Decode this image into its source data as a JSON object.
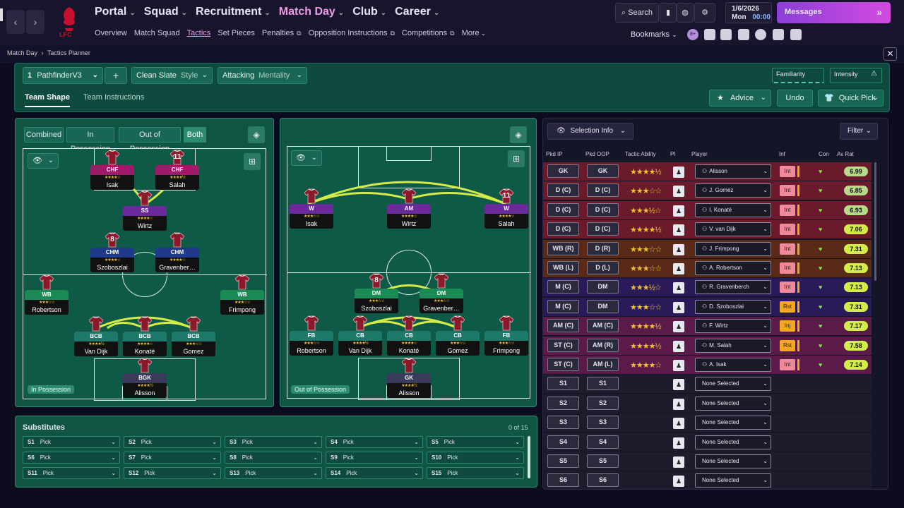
{
  "topbar": {
    "nav": [
      {
        "label": "Portal",
        "active": false
      },
      {
        "label": "Squad",
        "active": false
      },
      {
        "label": "Recruitment",
        "active": false
      },
      {
        "label": "Match Day",
        "active": true
      },
      {
        "label": "Club",
        "active": false
      },
      {
        "label": "Career",
        "active": false
      }
    ],
    "subnav": [
      "Overview",
      "Match Squad",
      "Tactics",
      "Set Pieces",
      "Penalties",
      "Opposition Instructions",
      "Competitions",
      "More"
    ],
    "subnav_active": "Tactics",
    "search_label": "Search",
    "date_line1": "1/6/2026",
    "date_day": "Mon",
    "date_time": "00:00",
    "messages_label": "Messages",
    "bookmarks_label": "Bookmarks",
    "badge": "8+",
    "crest_text": "LFC"
  },
  "breadcrumb": {
    "parent": "Match Day",
    "current": "Tactics Planner"
  },
  "tactic": {
    "number": "1",
    "name": "PathfinderV3",
    "add": "+",
    "style": "Clean Slate",
    "style_label": "Style",
    "mentality": "Attacking",
    "mentality_label": "Mentality",
    "familiarity": "Familiarity",
    "intensity": "Intensity"
  },
  "tabs": {
    "shape": "Team Shape",
    "instructions": "Team Instructions"
  },
  "actions": {
    "advice": "Advice",
    "undo": "Undo",
    "quick_pick": "Quick Pick"
  },
  "phase_buttons": [
    "Combined",
    "In Possession",
    "Out of Possession",
    "Both"
  ],
  "phase_active": "Both",
  "pitch_labels": {
    "in": "In Possession",
    "out": "Out of Possession"
  },
  "in_possession": [
    {
      "role": "CHF",
      "name": "Isak",
      "num": "",
      "rc": "r-pink",
      "stars": "★★★★☆"
    },
    {
      "role": "CHF",
      "name": "Salah",
      "num": "11",
      "rc": "r-pink",
      "stars": "★★★★½"
    },
    {
      "role": "SS",
      "name": "Wirtz",
      "num": "",
      "rc": "r-purple",
      "stars": "★★★★☆"
    },
    {
      "role": "CHM",
      "name": "Szoboszlai",
      "num": "8",
      "rc": "r-blue",
      "stars": "★★★★☆"
    },
    {
      "role": "CHM",
      "name": "Gravenber…",
      "num": "",
      "rc": "r-blue",
      "stars": "★★★★☆"
    },
    {
      "role": "WB",
      "name": "Robertson",
      "num": "",
      "rc": "r-green",
      "stars": "★★★☆☆"
    },
    {
      "role": "WB",
      "name": "Frimpong",
      "num": "",
      "rc": "r-green",
      "stars": "★★★☆☆"
    },
    {
      "role": "BCB",
      "name": "Van Dijk",
      "num": "",
      "rc": "r-teal",
      "stars": "★★★★½"
    },
    {
      "role": "BCB",
      "name": "Konaté",
      "num": "",
      "rc": "r-teal",
      "stars": "★★★★☆"
    },
    {
      "role": "BCB",
      "name": "Gomez",
      "num": "",
      "rc": "r-teal",
      "stars": "★★★☆☆"
    },
    {
      "role": "BGK",
      "name": "Alisson",
      "num": "",
      "rc": "r-gk",
      "stars": "★★★★½"
    }
  ],
  "out_possession": [
    {
      "role": "W",
      "name": "Isak",
      "num": "",
      "rc": "r-purple",
      "stars": "★★★☆☆"
    },
    {
      "role": "AM",
      "name": "Wirtz",
      "num": "",
      "rc": "r-purple",
      "stars": "★★★★☆"
    },
    {
      "role": "W",
      "name": "Salah",
      "num": "11",
      "rc": "r-purple",
      "stars": "★★★★☆"
    },
    {
      "role": "DM",
      "name": "Szoboszlai",
      "num": "8",
      "rc": "r-green",
      "stars": "★★★☆☆"
    },
    {
      "role": "DM",
      "name": "Gravenber…",
      "num": "",
      "rc": "r-green",
      "stars": "★★★☆☆"
    },
    {
      "role": "FB",
      "name": "Robertson",
      "num": "",
      "rc": "r-teal",
      "stars": "★★★☆☆"
    },
    {
      "role": "CB",
      "name": "Van Dijk",
      "num": "",
      "rc": "r-teal",
      "stars": "★★★★½"
    },
    {
      "role": "CB",
      "name": "Konaté",
      "num": "",
      "rc": "r-teal",
      "stars": "★★★★☆"
    },
    {
      "role": "CB",
      "name": "Gomez",
      "num": "",
      "rc": "r-teal",
      "stars": "★★★☆☆"
    },
    {
      "role": "FB",
      "name": "Frimpong",
      "num": "",
      "rc": "r-teal",
      "stars": "★★★☆☆"
    },
    {
      "role": "GK",
      "name": "Alisson",
      "num": "",
      "rc": "r-gk",
      "stars": "★★★★½"
    }
  ],
  "substitutes": {
    "title": "Substitutes",
    "count": "0 of 15",
    "slots": [
      "S1",
      "S2",
      "S3",
      "S4",
      "S5",
      "S6",
      "S7",
      "S8",
      "S9",
      "S10",
      "S11",
      "S12",
      "S13",
      "S14",
      "S15"
    ],
    "placeholder": "Pick"
  },
  "selection": {
    "title": "Selection Info",
    "filter": "Filter",
    "headers": [
      "Pkd IP",
      "Pkd OOP",
      "Tactic Ability",
      "PI",
      "Player",
      "Inf",
      "Con",
      "Av Rat"
    ],
    "rows": [
      {
        "ip": "GK",
        "oop": "GK",
        "stars": "★★★★½",
        "player": "Alisson",
        "inf": "Int",
        "rating": "6.99",
        "bg": "#6a1a2a",
        "rc": "#b8d98a"
      },
      {
        "ip": "D (C)",
        "oop": "D (C)",
        "stars": "★★★☆☆",
        "player": "J. Gomez",
        "inf": "Int",
        "rating": "6.85",
        "bg": "#6a1a2a",
        "rc": "#b8d98a"
      },
      {
        "ip": "D (C)",
        "oop": "D (C)",
        "stars": "★★★½☆",
        "player": "I. Konaté",
        "inf": "Int",
        "rating": "6.93",
        "bg": "#6a1a2a",
        "rc": "#b8d98a"
      },
      {
        "ip": "D (C)",
        "oop": "D (C)",
        "stars": "★★★★½",
        "player": "V. van Dijk",
        "inf": "Int",
        "rating": "7.06",
        "bg": "#6a1a2a",
        "rc": "#d4ec4a"
      },
      {
        "ip": "WB (R)",
        "oop": "D (R)",
        "stars": "★★★☆☆",
        "player": "J. Frimpong",
        "inf": "Int",
        "rating": "7.31",
        "bg": "#5a2a18",
        "rc": "#d4ec4a"
      },
      {
        "ip": "WB (L)",
        "oop": "D (L)",
        "stars": "★★★☆☆",
        "player": "A. Robertson",
        "inf": "Int",
        "rating": "7.13",
        "bg": "#5a2a18",
        "rc": "#d4ec4a"
      },
      {
        "ip": "M (C)",
        "oop": "DM",
        "stars": "★★★½☆",
        "player": "R. Gravenberch",
        "inf": "Int",
        "rating": "7.13",
        "bg": "#2a1a5a",
        "rc": "#d4ec4a"
      },
      {
        "ip": "M (C)",
        "oop": "DM",
        "stars": "★★★☆☆",
        "player": "D. Szoboszlai",
        "inf": "Rst",
        "rating": "7.31",
        "bg": "#2a1a5a",
        "rc": "#d4ec4a"
      },
      {
        "ip": "AM (C)",
        "oop": "AM (C)",
        "stars": "★★★★½",
        "player": "F. Wirtz",
        "inf": "Inj",
        "rating": "7.17",
        "bg": "#5a1a4a",
        "rc": "#d4ec4a"
      },
      {
        "ip": "ST (C)",
        "oop": "AM (R)",
        "stars": "★★★★½",
        "player": "M. Salah",
        "inf": "Rst",
        "rating": "7.58",
        "bg": "#5a1a4a",
        "rc": "#d4ec4a"
      },
      {
        "ip": "ST (C)",
        "oop": "AM (L)",
        "stars": "★★★★☆",
        "player": "A. Isak",
        "inf": "Int",
        "rating": "7.14",
        "bg": "#5a1a4a",
        "rc": "#d4ec4a"
      },
      {
        "ip": "S1",
        "oop": "S1",
        "stars": "",
        "player": "None Selected",
        "inf": "",
        "rating": "",
        "bg": "#1c1c2c",
        "rc": ""
      },
      {
        "ip": "S2",
        "oop": "S2",
        "stars": "",
        "player": "None Selected",
        "inf": "",
        "rating": "",
        "bg": "#1c1c2c",
        "rc": ""
      },
      {
        "ip": "S3",
        "oop": "S3",
        "stars": "",
        "player": "None Selected",
        "inf": "",
        "rating": "",
        "bg": "#1c1c2c",
        "rc": ""
      },
      {
        "ip": "S4",
        "oop": "S4",
        "stars": "",
        "player": "None Selected",
        "inf": "",
        "rating": "",
        "bg": "#1c1c2c",
        "rc": ""
      },
      {
        "ip": "S5",
        "oop": "S5",
        "stars": "",
        "player": "None Selected",
        "inf": "",
        "rating": "",
        "bg": "#1c1c2c",
        "rc": ""
      },
      {
        "ip": "S6",
        "oop": "S6",
        "stars": "",
        "player": "None Selected",
        "inf": "",
        "rating": "",
        "bg": "#1c1c2c",
        "rc": ""
      }
    ]
  }
}
